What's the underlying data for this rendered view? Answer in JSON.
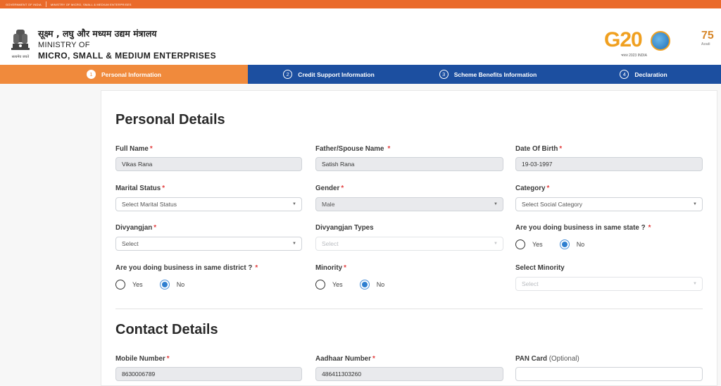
{
  "topbar": {
    "left": "GOVERNMENT OF INDIA",
    "right": "MINISTRY OF MICRO, SMALL & MEDIUM ENTERPRISES"
  },
  "header": {
    "hindi": "सूक्ष्म , लघु और मध्यम उद्यम मंत्रालय",
    "line2": "MINISTRY OF",
    "line3": "MICRO, SMALL & MEDIUM ENTERPRISES",
    "emblem_caption": "सत्यमेव जयते",
    "g20_label": "G20",
    "g20_sub": "भारत 2023 INDIA",
    "azadi_num": "75",
    "azadi_text": "Azadi"
  },
  "steps": [
    {
      "num": "1",
      "label": "Personal Information",
      "active": true
    },
    {
      "num": "2",
      "label": "Credit Support Information",
      "active": false
    },
    {
      "num": "3",
      "label": "Scheme Benefits Information",
      "active": false
    },
    {
      "num": "4",
      "label": "Declaration",
      "active": false
    }
  ],
  "personal": {
    "title": "Personal Details",
    "full_name": {
      "label": "Full Name",
      "value": "Vikas Rana"
    },
    "father": {
      "label": "Father/Spouse Name",
      "value": "Satish Rana"
    },
    "dob": {
      "label": "Date Of Birth",
      "value": "19-03-1997"
    },
    "marital": {
      "label": "Marital Status",
      "value": "Select Marital Status"
    },
    "gender": {
      "label": "Gender",
      "value": "Male"
    },
    "category": {
      "label": "Category",
      "value": "Select Social Category"
    },
    "divyangjan": {
      "label": "Divyangjan",
      "value": "Select"
    },
    "divyangjan_types": {
      "label": "Divyangjan Types",
      "value": "Select"
    },
    "same_state": {
      "label": "Are you doing business in same state ?",
      "yes": "Yes",
      "no": "No",
      "selected": "No"
    },
    "same_district": {
      "label": "Are you doing business in same district ?",
      "yes": "Yes",
      "no": "No",
      "selected": "No"
    },
    "minority": {
      "label": "Minority",
      "yes": "Yes",
      "no": "No",
      "selected": "No"
    },
    "select_minority": {
      "label": "Select Minority",
      "value": "Select"
    }
  },
  "contact": {
    "title": "Contact Details",
    "mobile": {
      "label": "Mobile Number",
      "value": "8630006789"
    },
    "aadhaar": {
      "label": "Aadhaar Number",
      "value": "486411303260"
    },
    "pan": {
      "label": "PAN Card",
      "optional": "(Optional)",
      "value": ""
    }
  },
  "colors": {
    "orange": "#f08a3c",
    "blue": "#1c4fa0",
    "required": "#e23b3b"
  }
}
